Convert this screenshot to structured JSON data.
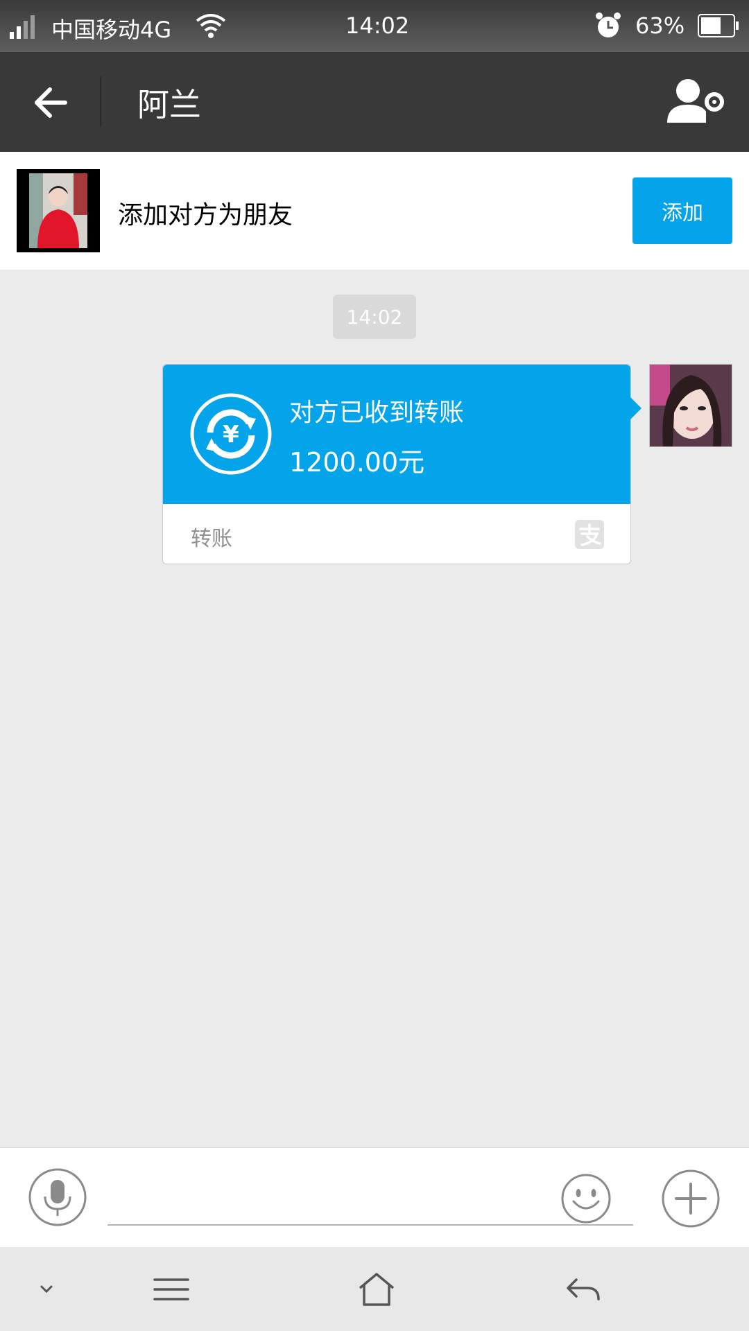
{
  "status_bar": {
    "carrier": "中国移动4G",
    "time": "14:02",
    "battery_percent": "63%",
    "battery_level": 0.63
  },
  "header": {
    "title": "阿兰"
  },
  "add_friend_banner": {
    "text": "添加对方为朋友",
    "button_label": "添加"
  },
  "chat": {
    "time_chip": "14:02",
    "transfer_card": {
      "status": "对方已收到转账",
      "amount": "1200.00元",
      "footer_label": "转账"
    }
  },
  "input_bar": {
    "placeholder": ""
  },
  "colors": {
    "accent": "#04a4ea",
    "header_bg": "#393939",
    "chat_bg": "#ebebeb"
  },
  "icons": {
    "back": "arrow-left-icon",
    "profile_settings": "user-gear-icon",
    "transfer": "yuan-refresh-icon",
    "alipay": "alipay-icon",
    "mic": "microphone-icon",
    "emoji": "smiley-icon",
    "plus": "plus-icon"
  }
}
